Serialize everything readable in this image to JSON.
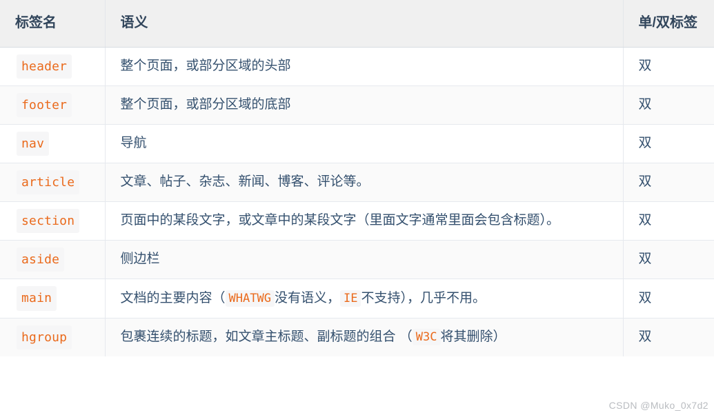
{
  "table": {
    "headers": {
      "tag_name": "标签名",
      "semantics": "语义",
      "tag_kind": "单/双标签"
    },
    "rows": [
      {
        "tag": "header",
        "kind": "双",
        "desc_parts": [
          {
            "type": "text",
            "value": "整个页面，或部分区域的头部"
          }
        ]
      },
      {
        "tag": "footer",
        "kind": "双",
        "desc_parts": [
          {
            "type": "text",
            "value": "整个页面，或部分区域的底部"
          }
        ]
      },
      {
        "tag": "nav",
        "kind": "双",
        "desc_parts": [
          {
            "type": "text",
            "value": "导航"
          }
        ]
      },
      {
        "tag": "article",
        "kind": "双",
        "desc_parts": [
          {
            "type": "text",
            "value": "文章、帖子、杂志、新闻、博客、评论等。"
          }
        ]
      },
      {
        "tag": "section",
        "kind": "双",
        "desc_parts": [
          {
            "type": "text",
            "value": "页面中的某段文字，或文章中的某段文字（里面文字通常里面会包含标题）。"
          }
        ]
      },
      {
        "tag": "aside",
        "kind": "双",
        "desc_parts": [
          {
            "type": "text",
            "value": "侧边栏"
          }
        ]
      },
      {
        "tag": "main",
        "kind": "双",
        "desc_parts": [
          {
            "type": "text",
            "value": "文档的主要内容（"
          },
          {
            "type": "code",
            "value": "WHATWG"
          },
          {
            "type": "text",
            "value": "没有语义，"
          },
          {
            "type": "code",
            "value": "IE"
          },
          {
            "type": "text",
            "value": "不支持），几乎不用。"
          }
        ]
      },
      {
        "tag": "hgroup",
        "kind": "双",
        "desc_parts": [
          {
            "type": "text",
            "value": "包裹连续的标题，如文章主标题、副标题的组合 （"
          },
          {
            "type": "code",
            "value": "W3C"
          },
          {
            "type": "text",
            "value": "将其删除）"
          }
        ]
      }
    ]
  },
  "watermark": {
    "text": "CSDN @Muko_0x7d2"
  },
  "colors": {
    "header_bg": "#f0f0f0",
    "header_text": "#31455b",
    "body_text": "#34506e",
    "code_orange": "#ea6a1c",
    "code_bg": "#f6f6f7",
    "row_alt_bg": "#fafafa",
    "border": "#e6e9ee",
    "watermark": "#b9bcc0"
  }
}
